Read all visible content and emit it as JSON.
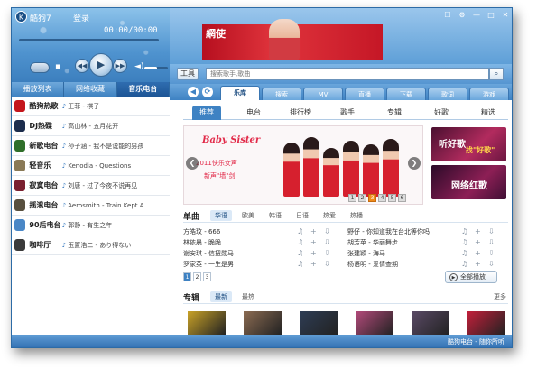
{
  "app": {
    "title": "酷狗7",
    "login": "登录"
  },
  "player": {
    "time": "00:00/00:00",
    "progress": 0.0,
    "volume": 0.55
  },
  "left_tabs": [
    {
      "label": "播放列表"
    },
    {
      "label": "网络收藏"
    },
    {
      "label": "音乐电台"
    }
  ],
  "stations": [
    {
      "name": "酷狗热歌",
      "song": "王菲 - 棋子",
      "color": "#c4161c"
    },
    {
      "name": "DJ热碟",
      "song": "高山林 - 五月花开",
      "color": "#1c2d4d"
    },
    {
      "name": "新歌电台",
      "song": "孙子涵 - 我不是说能的男孩",
      "color": "#2f6f2a"
    },
    {
      "name": "轻音乐",
      "song": "Kenodia - Questions",
      "color": "#8a7a57"
    },
    {
      "name": "寂寞电台",
      "song": "刘唐 - 过了今夜不说再见",
      "color": "#7a2030"
    },
    {
      "name": "摇滚电台",
      "song": "Aerosmith - Train Kept A",
      "color": "#58503f"
    },
    {
      "name": "90后电台",
      "song": "郭静 - 有生之年",
      "color": "#4a87c6"
    },
    {
      "name": "咖啡厅",
      "song": "玉置浩二 - あり得ない",
      "color": "#3a3a3a"
    }
  ],
  "banner": {
    "logo": "網使"
  },
  "toolbar": {
    "tools_label": "工具",
    "search_placeholder": "搜索歌手,歌曲"
  },
  "nav_tabs": [
    {
      "label": "乐库",
      "active": true
    },
    {
      "label": "搜索"
    },
    {
      "label": "MV"
    },
    {
      "label": "直播"
    },
    {
      "label": "下载"
    },
    {
      "label": "歌词"
    },
    {
      "label": "游戏"
    }
  ],
  "sub_tabs": [
    {
      "label": "推荐",
      "active": true
    },
    {
      "label": "电台"
    },
    {
      "label": "排行榜"
    },
    {
      "label": "歌手"
    },
    {
      "label": "专辑"
    },
    {
      "label": "好歌"
    },
    {
      "label": "精选"
    }
  ],
  "carousel": {
    "title": "Baby Sister",
    "sub1": "2011快乐女声",
    "sub2": "新声\"墙\"剑",
    "pages": [
      "1",
      "2",
      "3",
      "4",
      "5",
      "6"
    ],
    "active_page": 3
  },
  "promos": [
    {
      "text": "听好歌",
      "text2": "找\"好歌\""
    },
    {
      "text": "网络红歌",
      "text2": ""
    }
  ],
  "songs": {
    "title": "单曲",
    "filters": [
      {
        "label": "华语",
        "active": true
      },
      {
        "label": "欧美"
      },
      {
        "label": "韩语"
      },
      {
        "label": "日语"
      },
      {
        "label": "热爱"
      },
      {
        "label": "热播"
      }
    ],
    "left": [
      "方皓玟 - 666",
      "林依晨 - 脆脆",
      "谢安琪 - 信扭勋马",
      "罗家英 - 一生是男"
    ],
    "right": [
      "野仔 - 你知道我在台北等你吗",
      "胡芳苹 - 华丽舞步",
      "张建颖 - 海马",
      "杨语明 - 爱情查期"
    ],
    "pages": [
      "1",
      "2",
      "3"
    ],
    "play_all": "全部播放"
  },
  "albums": {
    "title": "专辑",
    "filters": [
      {
        "label": "最新",
        "active": true
      },
      {
        "label": "最热"
      }
    ],
    "more": "更多",
    "covers": [
      "#c9a227",
      "#8b6b52",
      "#2e3d55",
      "#b34a7a",
      "#5a4a66",
      "#c21f3a"
    ]
  },
  "status": {
    "text": "酷狗电台 - 随你所听"
  },
  "colors": {
    "accent": "#3e82c3",
    "frame": "#2c6ba6",
    "active_page": "#f08a1a"
  }
}
